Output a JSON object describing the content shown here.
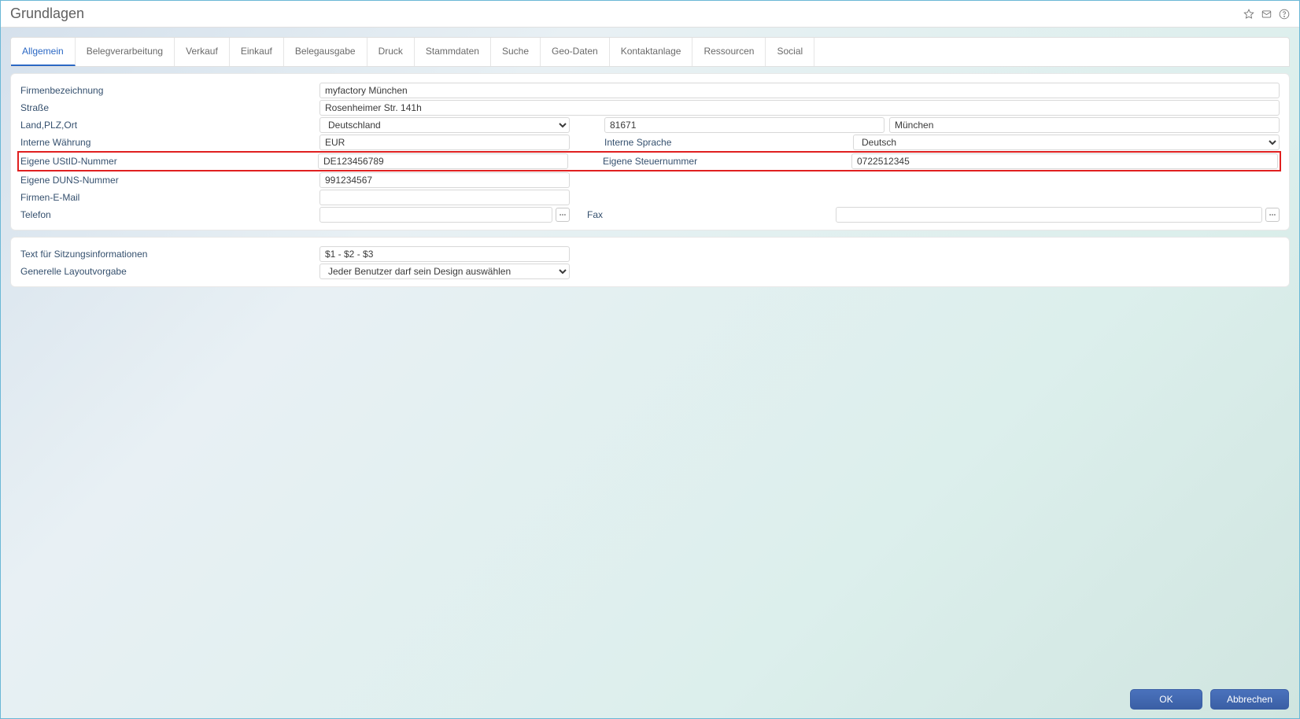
{
  "header": {
    "title": "Grundlagen"
  },
  "tabs": [
    {
      "id": "allgemein",
      "label": "Allgemein",
      "active": true
    },
    {
      "id": "belegverarbeitung",
      "label": "Belegverarbeitung"
    },
    {
      "id": "verkauf",
      "label": "Verkauf"
    },
    {
      "id": "einkauf",
      "label": "Einkauf"
    },
    {
      "id": "belegausgabe",
      "label": "Belegausgabe"
    },
    {
      "id": "druck",
      "label": "Druck"
    },
    {
      "id": "stammdaten",
      "label": "Stammdaten"
    },
    {
      "id": "suche",
      "label": "Suche"
    },
    {
      "id": "geodaten",
      "label": "Geo-Daten"
    },
    {
      "id": "kontaktanlage",
      "label": "Kontaktanlage"
    },
    {
      "id": "ressourcen",
      "label": "Ressourcen"
    },
    {
      "id": "social",
      "label": "Social"
    }
  ],
  "form": {
    "firmenbezeichnung_label": "Firmenbezeichnung",
    "firmenbezeichnung_value": "myfactory München",
    "strasse_label": "Straße",
    "strasse_value": "Rosenheimer Str. 141h",
    "landplzort_label": "Land,PLZ,Ort",
    "land_value": "Deutschland",
    "plz_value": "81671",
    "ort_value": "München",
    "waehrung_label": "Interne Währung",
    "waehrung_value": "EUR",
    "sprache_label": "Interne Sprache",
    "sprache_value": "Deutsch",
    "ustid_label": "Eigene UStID-Nummer",
    "ustid_value": "DE123456789",
    "steuernummer_label": "Eigene Steuernummer",
    "steuernummer_value": "0722512345",
    "duns_label": "Eigene DUNS-Nummer",
    "duns_value": "991234567",
    "firmen_email_label": "Firmen-E-Mail",
    "firmen_email_value": "",
    "telefon_label": "Telefon",
    "telefon_value": "",
    "fax_label": "Fax",
    "fax_value": ""
  },
  "form2": {
    "sitzungsinfo_label": "Text für Sitzungsinformationen",
    "sitzungsinfo_value": "$1 - $2 - $3",
    "layoutvorgabe_label": "Generelle Layoutvorgabe",
    "layoutvorgabe_value": "Jeder Benutzer darf sein Design auswählen"
  },
  "footer": {
    "ok_label": "OK",
    "cancel_label": "Abbrechen"
  }
}
